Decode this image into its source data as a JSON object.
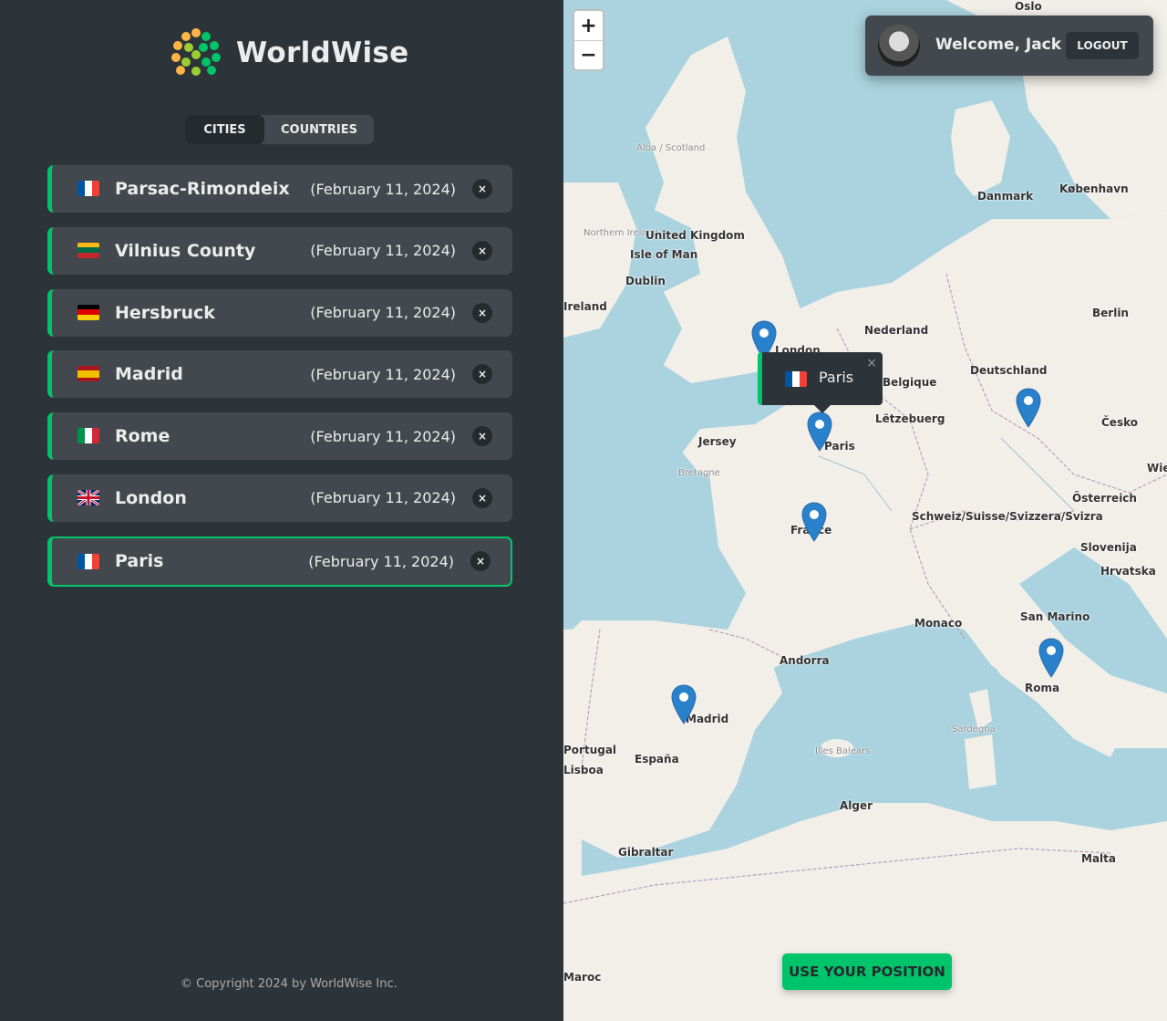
{
  "app": {
    "name": "WorldWise"
  },
  "tabs": [
    {
      "label": "CITIES",
      "active": true
    },
    {
      "label": "COUNTRIES",
      "active": false
    }
  ],
  "cities": [
    {
      "name": "Parsac-Rimondeix",
      "date": "(February 11, 2024)",
      "flag": "France",
      "active": false
    },
    {
      "name": "Vilnius County",
      "date": "(February 11, 2024)",
      "flag": "Lithuania",
      "active": false
    },
    {
      "name": "Hersbruck",
      "date": "(February 11, 2024)",
      "flag": "Germany",
      "active": false
    },
    {
      "name": "Madrid",
      "date": "(February 11, 2024)",
      "flag": "Spain",
      "active": false
    },
    {
      "name": "Rome",
      "date": "(February 11, 2024)",
      "flag": "Italy",
      "active": false
    },
    {
      "name": "London",
      "date": "(February 11, 2024)",
      "flag": "United Kingdom",
      "active": false
    },
    {
      "name": "Paris",
      "date": "(February 11, 2024)",
      "flag": "France",
      "active": true
    }
  ],
  "delete_label": "×",
  "footer": {
    "copyright": "© Copyright 2024 by WorldWise Inc."
  },
  "map": {
    "zoom_in": "+",
    "zoom_out": "−",
    "user": {
      "welcome": "Welcome, Jack",
      "logout": "LOGOUT"
    },
    "popup": {
      "name": "Paris",
      "close": "×"
    },
    "use_position": "USE YOUR POSITION",
    "labels": [
      "Oslo",
      "Alba / Scotland",
      "Danmark",
      "København",
      "Northern Ireland",
      "United Kingdom",
      "Isle of Man",
      "Dublin",
      "Ireland",
      "Berlin",
      "Nederland",
      "Deutschland",
      "London",
      "Belgique",
      "Lëtzebuerg",
      "Česko",
      "Jersey",
      "Bretagne",
      "Paris",
      "France",
      "Österreich",
      "Schweiz/Suisse/Svizzera/Svizra",
      "Slovenija",
      "Hrvatska",
      "Monaco",
      "San Marino",
      "Andorra",
      "Madrid",
      "España",
      "Portugal",
      "Lisboa",
      "Roma",
      "Illes Balears",
      "Sardegna",
      "Alger",
      "Gibraltar",
      "Malta",
      "Maroc",
      "Wien"
    ]
  },
  "colors": {
    "accent": "#00c46a",
    "sidebar_bg": "#2d3439",
    "item_bg": "#42484d",
    "dark": "#242a2e",
    "sea": "#aad3df",
    "land": "#f2efe9"
  }
}
